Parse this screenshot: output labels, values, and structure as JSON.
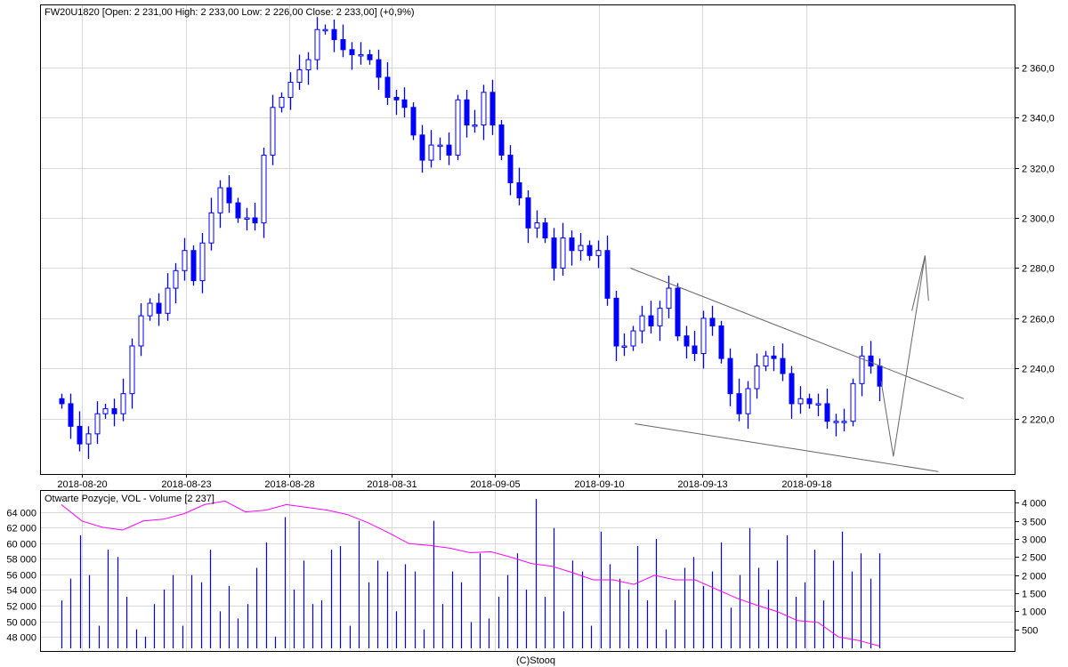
{
  "chart_data": [
    {
      "type": "candlestick",
      "title": "FW20U1820 [Open: 2 231,00  High: 2 233,00  Low: 2 226,00  Close: 2 233,00] (+0,9%)",
      "y_ticks": [
        "2 220,0",
        "2 240,0",
        "2 260,0",
        "2 280,0",
        "2 300,0",
        "2 320,0",
        "2 340,0",
        "2 360,0"
      ],
      "y_tick_values": [
        2220,
        2240,
        2260,
        2280,
        2300,
        2320,
        2340,
        2360
      ],
      "ylim": [
        2198,
        2385
      ],
      "x_ticks": [
        "2018-08-20",
        "2018-08-23",
        "2018-08-28",
        "2018-08-31",
        "2018-09-05",
        "2018-09-10",
        "2018-09-13",
        "2018-09-18"
      ],
      "x_tick_index": [
        2.3,
        14.2,
        25.9,
        37.5,
        49.3,
        61.1,
        72.9,
        84.7
      ],
      "x_index_range": [
        -2.3,
        102.6
      ],
      "grid": true,
      "colors": {
        "candle": "#0000ff",
        "grid": "#d9d9d9",
        "drawing": "#666666"
      },
      "closes": [
        2226,
        2217,
        2210,
        2214,
        2222,
        2224,
        2222,
        2230,
        2249,
        2261,
        2266,
        2262,
        2272,
        2279,
        2287,
        2275,
        2290,
        2302,
        2312,
        2306,
        2300,
        2300,
        2298,
        2325,
        2344,
        2348,
        2354,
        2359,
        2363,
        2375,
        2375,
        2371,
        2367,
        2365,
        2365,
        2363,
        2356,
        2348,
        2347,
        2344,
        2333,
        2323,
        2329,
        2329,
        2325,
        2347,
        2337,
        2337,
        2350,
        2337,
        2325,
        2314,
        2308,
        2296,
        2298,
        2292,
        2280,
        2292,
        2287,
        2289,
        2285,
        2287,
        2268,
        2249,
        2249,
        2255,
        2261,
        2257,
        2264,
        2272,
        2253,
        2249,
        2246,
        2260,
        2257,
        2244,
        2230,
        2222,
        2232,
        2241,
        2245,
        2244,
        2238,
        2226,
        2228,
        2226,
        2226,
        2219,
        2219,
        2219,
        2234,
        2245,
        2241,
        2233
      ],
      "first_open": 2228,
      "trendlines": [
        {
          "name": "upper-trendline",
          "points": [
            [
              64.7,
              2280
            ],
            [
              102.6,
              2228
            ]
          ]
        },
        {
          "name": "lower-trendline",
          "points": [
            [
              65.2,
              2218
            ],
            [
              99.7,
              2199
            ]
          ]
        },
        {
          "name": "projection-path",
          "points": [
            [
              93.2,
              2235
            ],
            [
              94.6,
              2205
            ],
            [
              98.2,
              2285
            ],
            [
              98.6,
              2267
            ]
          ]
        },
        {
          "name": "projection-arrow-wing",
          "points": [
            [
              96.7,
              2263
            ],
            [
              98.2,
              2285
            ]
          ]
        }
      ]
    },
    {
      "type": "bar+line",
      "title": "Otwarte Pozycje, VOL - Volume [2 237]",
      "left_ticks": [
        "48 000",
        "50 000",
        "52 000",
        "54 000",
        "56 000",
        "58 000",
        "60 000",
        "62 000",
        "64 000"
      ],
      "left_tick_values": [
        48000,
        50000,
        52000,
        54000,
        56000,
        58000,
        60000,
        62000,
        64000
      ],
      "left_ylim": [
        46200,
        66800
      ],
      "right_ticks": [
        "500",
        "1 000",
        "1 500",
        "2 000",
        "2 500",
        "3 000",
        "3 500",
        "4 000"
      ],
      "right_tick_values": [
        500,
        1000,
        1500,
        2000,
        2500,
        3000,
        3500,
        4000
      ],
      "right_ylim": [
        0,
        4350
      ],
      "colors": {
        "volume": "#0000ff",
        "open_interest": "#ff00ff"
      },
      "volume": [
        1300,
        1900,
        3100,
        2000,
        600,
        2700,
        2500,
        1400,
        500,
        300,
        1200,
        1600,
        2000,
        600,
        2000,
        1800,
        2700,
        1000,
        1700,
        800,
        1200,
        2200,
        2900,
        300,
        3600,
        1600,
        2400,
        1200,
        1300,
        2700,
        2800,
        600,
        3500,
        1800,
        2400,
        2100,
        1000,
        2300,
        2100,
        500,
        3500,
        1200,
        2100,
        1800,
        700,
        2600,
        800,
        1400,
        2000,
        2600,
        1600,
        4100,
        1400,
        3300,
        1000,
        2400,
        2100,
        600,
        3200,
        2300,
        1900,
        1600,
        2800,
        1300,
        3000,
        500,
        1300,
        2200,
        2500,
        1700,
        2100,
        2900,
        1100,
        2000,
        3300,
        2200,
        1600,
        2400,
        3100,
        1400,
        1800,
        2700,
        1300,
        2400,
        3200,
        2100,
        2600,
        1900,
        2600
      ],
      "open_interest": [
        64930,
        62840,
        62030,
        61680,
        62840,
        63070,
        63770,
        64930,
        65390,
        64000,
        64230,
        64930,
        64580,
        64230,
        63650,
        62610,
        61330,
        59940,
        59710,
        59360,
        58780,
        58900,
        58200,
        57390,
        57040,
        56230,
        55300,
        55300,
        54720,
        55880,
        55300,
        55300,
        54140,
        52990,
        52060,
        51250,
        50090,
        49860,
        48000,
        47540,
        46840
      ]
    }
  ],
  "footer": "(C)Stooq"
}
